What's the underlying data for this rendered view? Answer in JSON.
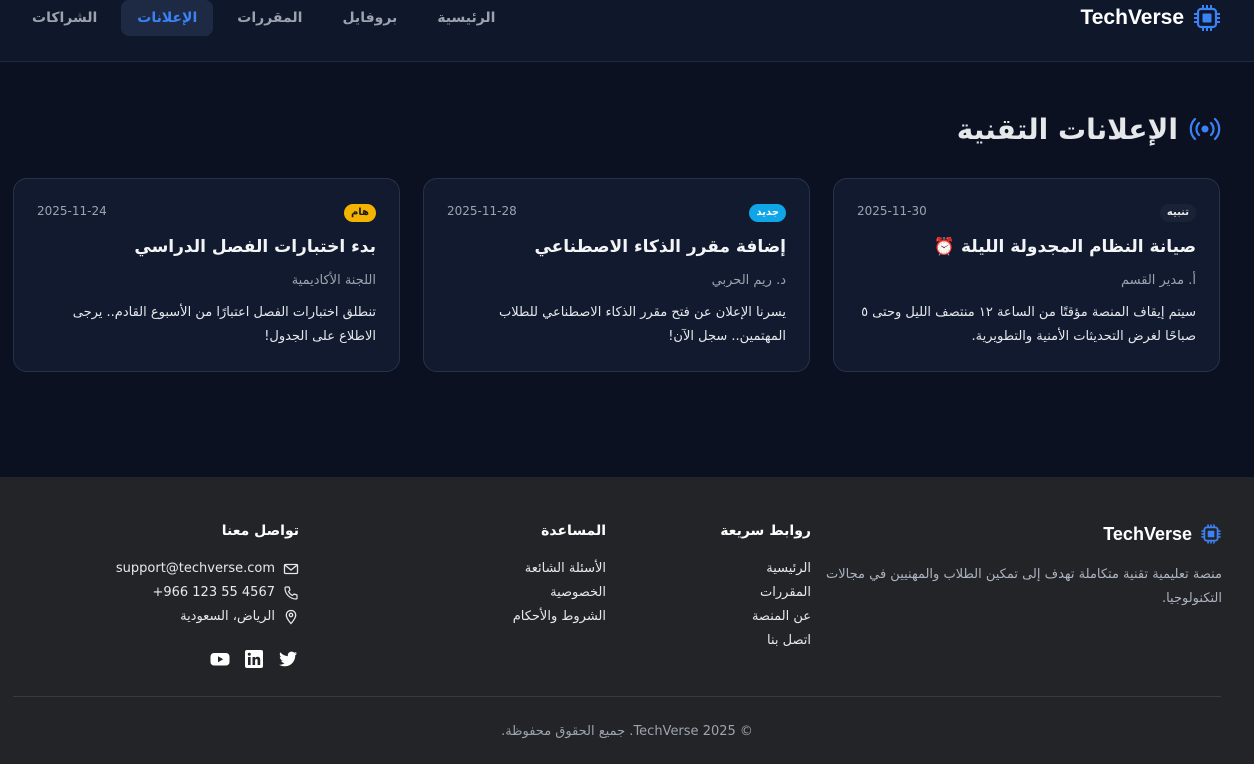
{
  "brand": {
    "name": "TechVerse"
  },
  "nav": {
    "items": [
      {
        "label": "الشراكات"
      },
      {
        "label": "الإعلانات"
      },
      {
        "label": "المقررات"
      },
      {
        "label": "بروفايل"
      },
      {
        "label": "الرئيسية"
      }
    ],
    "active_label": "الإعلانات"
  },
  "page": {
    "title": "الإعلانات التقنية"
  },
  "announcements": [
    {
      "badge": "تنبيه",
      "date": "2025-11-30",
      "title": "صيانة النظام المجدولة الليلة",
      "title_icon": "⏰",
      "author": "أ. مدير القسم",
      "body": "سيتم إيقاف المنصة مؤقتًا من الساعة ١٢ منتصف الليل وحتى ٥ صباحًا لغرض التحديثات الأمنية والتطويرية."
    },
    {
      "badge": "جديد",
      "date": "2025-11-28",
      "title": "إضافة مقرر الذكاء الاصطناعي",
      "author": "د. ريم الحربي",
      "body": "يسرنا الإعلان عن فتح مقرر الذكاء الاصطناعي للطلاب المهتمين.. سجل الآن!"
    },
    {
      "badge": "هام",
      "date": "2025-11-24",
      "title": "بدء اختبارات الفصل الدراسي",
      "author": "اللجنة الأكاديمية",
      "body": "تنطلق اختبارات الفصل اعتبارًا من الأسبوع القادم.. يرجى الاطلاع على الجدول!"
    }
  ],
  "footer": {
    "brand": "TechVerse",
    "description": "منصة تعليمية تقنية متكاملة تهدف إلى تمكين الطلاب والمهنيين في مجالات التكنولوجيا.",
    "quick_links": {
      "title": "روابط سريعة",
      "items": [
        "الرئيسية",
        "المقررات",
        "عن المنصة",
        "اتصل بنا"
      ]
    },
    "help": {
      "title": "المساعدة",
      "items": [
        "الأسئلة الشائعة",
        "الخصوصية",
        "الشروط والأحكام"
      ]
    },
    "contact": {
      "title": "تواصل معنا",
      "email": "support@techverse.com",
      "phone": "+966 123 55 4567",
      "location": "الرياض، السعودية"
    },
    "copyright": "© 2025 TechVerse. جميع الحقوق محفوظة."
  },
  "colors": {
    "accent": "#3b82f6",
    "badge_new": "#0ea5e9",
    "badge_important": "#f5b301"
  }
}
